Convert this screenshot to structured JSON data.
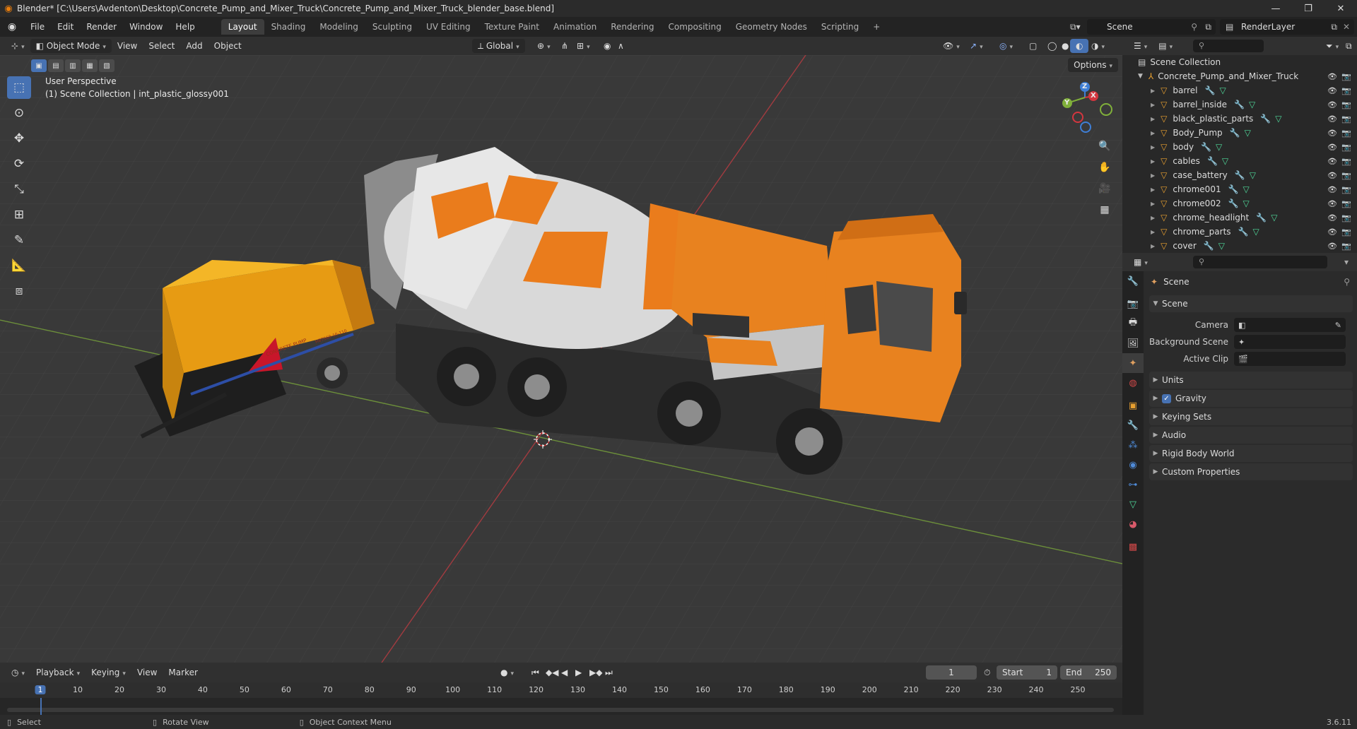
{
  "window": {
    "title": "Blender* [C:\\Users\\Avdenton\\Desktop\\Concrete_Pump_and_Mixer_Truck\\Concrete_Pump_and_Mixer_Truck_blender_base.blend]",
    "controls": {
      "minimize": "—",
      "maximize": "❐",
      "close": "✕"
    }
  },
  "menu": {
    "items": [
      "File",
      "Edit",
      "Render",
      "Window",
      "Help"
    ],
    "workspaces": [
      "Layout",
      "Shading",
      "Modeling",
      "Sculpting",
      "UV Editing",
      "Texture Paint",
      "Animation",
      "Rendering",
      "Compositing",
      "Geometry Nodes",
      "Scripting"
    ],
    "active_workspace": "Layout",
    "add_tab": "+",
    "scene": "Scene",
    "view_layer": "RenderLayer"
  },
  "viewport_header": {
    "mode": "Object Mode",
    "menus": [
      "View",
      "Select",
      "Add",
      "Object"
    ],
    "transform_orientation": "Global",
    "options": "Options"
  },
  "viewport": {
    "perspective": "User Perspective",
    "collection_info": "(1) Scene Collection | int_plastic_glossy001",
    "gizmo_axes": {
      "x": "X",
      "y": "Y",
      "z": "Z"
    },
    "vehicle_labels": {
      "pump_side": "CONCRETE PUMP",
      "pump_side2": "HBTS60-16-110"
    }
  },
  "outliner": {
    "root": "Scene Collection",
    "collection": "Concrete_Pump_and_Mixer_Truck",
    "objects": [
      "barrel",
      "barrel_inside",
      "black_plastic_parts",
      "Body_Pump",
      "body",
      "cables",
      "case_battery",
      "chrome001",
      "chrome002",
      "chrome_headlight",
      "chrome_parts",
      "cover"
    ]
  },
  "properties": {
    "context": "Scene",
    "panel_scene": "Scene",
    "fields": [
      {
        "label": "Camera",
        "value": ""
      },
      {
        "label": "Background Scene",
        "value": ""
      },
      {
        "label": "Active Clip",
        "value": ""
      }
    ],
    "panels": [
      "Units",
      "Gravity",
      "Keying Sets",
      "Audio",
      "Rigid Body World",
      "Custom Properties"
    ],
    "gravity_checked": true
  },
  "timeline": {
    "menus": [
      "Playback",
      "Keying",
      "View",
      "Marker"
    ],
    "current_frame": "1",
    "start_label": "Start",
    "start": "1",
    "end_label": "End",
    "end": "250",
    "ticks": [
      "1",
      "10",
      "20",
      "30",
      "40",
      "50",
      "60",
      "70",
      "80",
      "90",
      "100",
      "110",
      "120",
      "130",
      "140",
      "150",
      "160",
      "170",
      "180",
      "190",
      "200",
      "210",
      "220",
      "230",
      "240",
      "250"
    ]
  },
  "statusbar": {
    "select": "Select",
    "rotate": "Rotate View",
    "context_menu": "Object Context Menu",
    "version": "3.6.11"
  },
  "colors": {
    "accent": "#4772b3",
    "truck_orange": "#e8821f",
    "pump_yellow": "#f2a91a",
    "x_axis": "#d4363f",
    "y_axis": "#80b03a",
    "z_axis": "#3f7fd6"
  }
}
